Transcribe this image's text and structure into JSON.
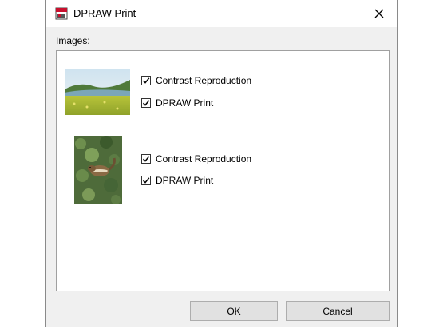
{
  "window": {
    "title": "DPRAW Print",
    "icon": "printer-icon",
    "close_icon": "close-icon"
  },
  "images_label": "Images:",
  "items": [
    {
      "thumbnail": "landscape-photo",
      "options": [
        {
          "label": "Contrast Reproduction",
          "checked": true
        },
        {
          "label": "DPRAW Print",
          "checked": true
        }
      ]
    },
    {
      "thumbnail": "chipmunk-photo",
      "options": [
        {
          "label": "Contrast Reproduction",
          "checked": true
        },
        {
          "label": "DPRAW Print",
          "checked": true
        }
      ]
    }
  ],
  "buttons": {
    "ok_label": "OK",
    "cancel_label": "Cancel"
  }
}
